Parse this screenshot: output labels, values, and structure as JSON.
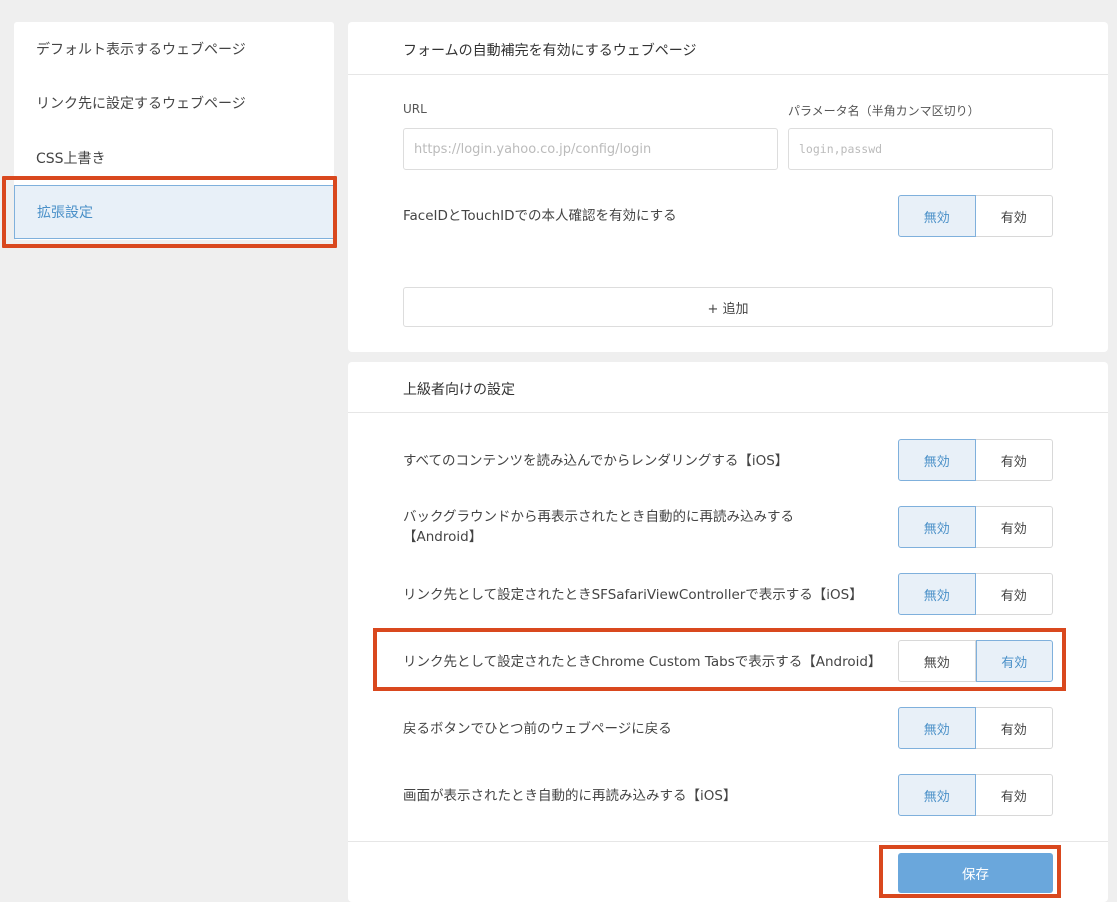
{
  "sidebar": {
    "items": [
      {
        "label": "デフォルト表示するウェブページ"
      },
      {
        "label": "リンク先に設定するウェブページ"
      },
      {
        "label": "CSS上書き"
      },
      {
        "label": "拡張設定"
      }
    ]
  },
  "autofill": {
    "title": "フォームの自動補完を有効にするウェブページ",
    "url_label": "URL",
    "url_placeholder": "https://login.yahoo.co.jp/config/login",
    "param_label": "パラメータ名（半角カンマ区切り）",
    "param_placeholder": "login,passwd",
    "faceid_label": "FaceIDとTouchIDでの本人確認を有効にする",
    "faceid_state": "無効",
    "add_label": "+ 追加"
  },
  "toggle_labels": {
    "off": "無効",
    "on": "有効"
  },
  "advanced": {
    "title": "上級者向けの設定",
    "settings": [
      {
        "label": "すべてのコンテンツを読み込んでからレンダリングする【iOS】",
        "state": "無効"
      },
      {
        "label": "バックグラウンドから再表示されたとき自動的に再読み込みする【Android】",
        "state": "無効"
      },
      {
        "label": "リンク先として設定されたときSFSafariViewControllerで表示する【iOS】",
        "state": "無効"
      },
      {
        "label": "リンク先として設定されたときChrome Custom Tabsで表示する【Android】",
        "state": "有効"
      },
      {
        "label": "戻るボタンでひとつ前のウェブページに戻る",
        "state": "無効"
      },
      {
        "label": "画面が表示されたとき自動的に再読み込みする【iOS】",
        "state": "無効"
      }
    ],
    "save_label": "保存"
  },
  "colors": {
    "accent": "#4a90c8",
    "highlight": "#d9481e",
    "save": "#6aa7dc"
  }
}
